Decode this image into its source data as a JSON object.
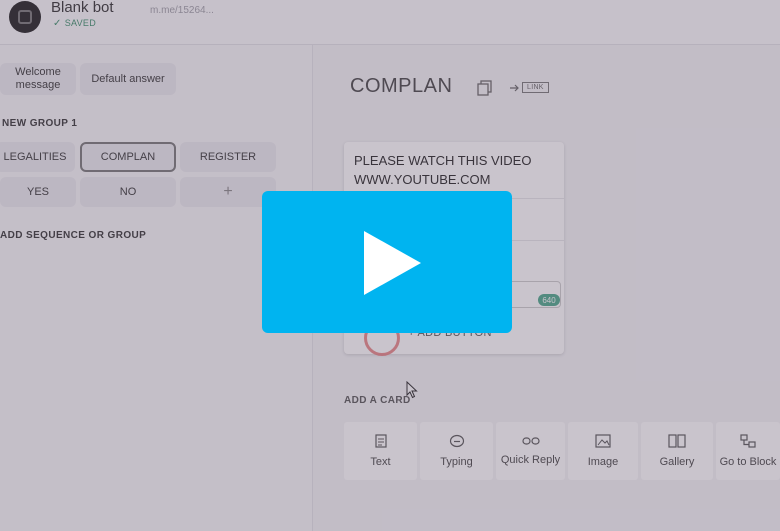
{
  "header": {
    "bot_name": "Blank bot",
    "saved_label": "SAVED",
    "url": "m.me/15264..."
  },
  "sidebar": {
    "welcome_label": "Welcome message",
    "default_answer_label": "Default answer",
    "group_title": "NEW GROUP 1",
    "blocks": [
      "LEGALITIES",
      "COMPLAN",
      "REGISTER",
      "YES",
      "NO",
      "+"
    ],
    "add_sequence_label": "ADD SEQUENCE OR GROUP"
  },
  "editor": {
    "title": "COMPLAN",
    "link_label": "LINK",
    "message_text": "PLEASE WATCH THIS VIDEO WWW.YOUTUBE.COM",
    "char_counter": "640",
    "add_button_label": "ADD BUTTON",
    "add_card_title": "ADD A CARD",
    "card_tools": [
      "Text",
      "Typing",
      "Quick Reply",
      "Image",
      "Gallery",
      "Go to Block"
    ]
  },
  "colors": {
    "play_button": "#00b4f0",
    "saved_green": "#3a8f6a",
    "overlay": "rgba(100,85,110,0.35)"
  }
}
